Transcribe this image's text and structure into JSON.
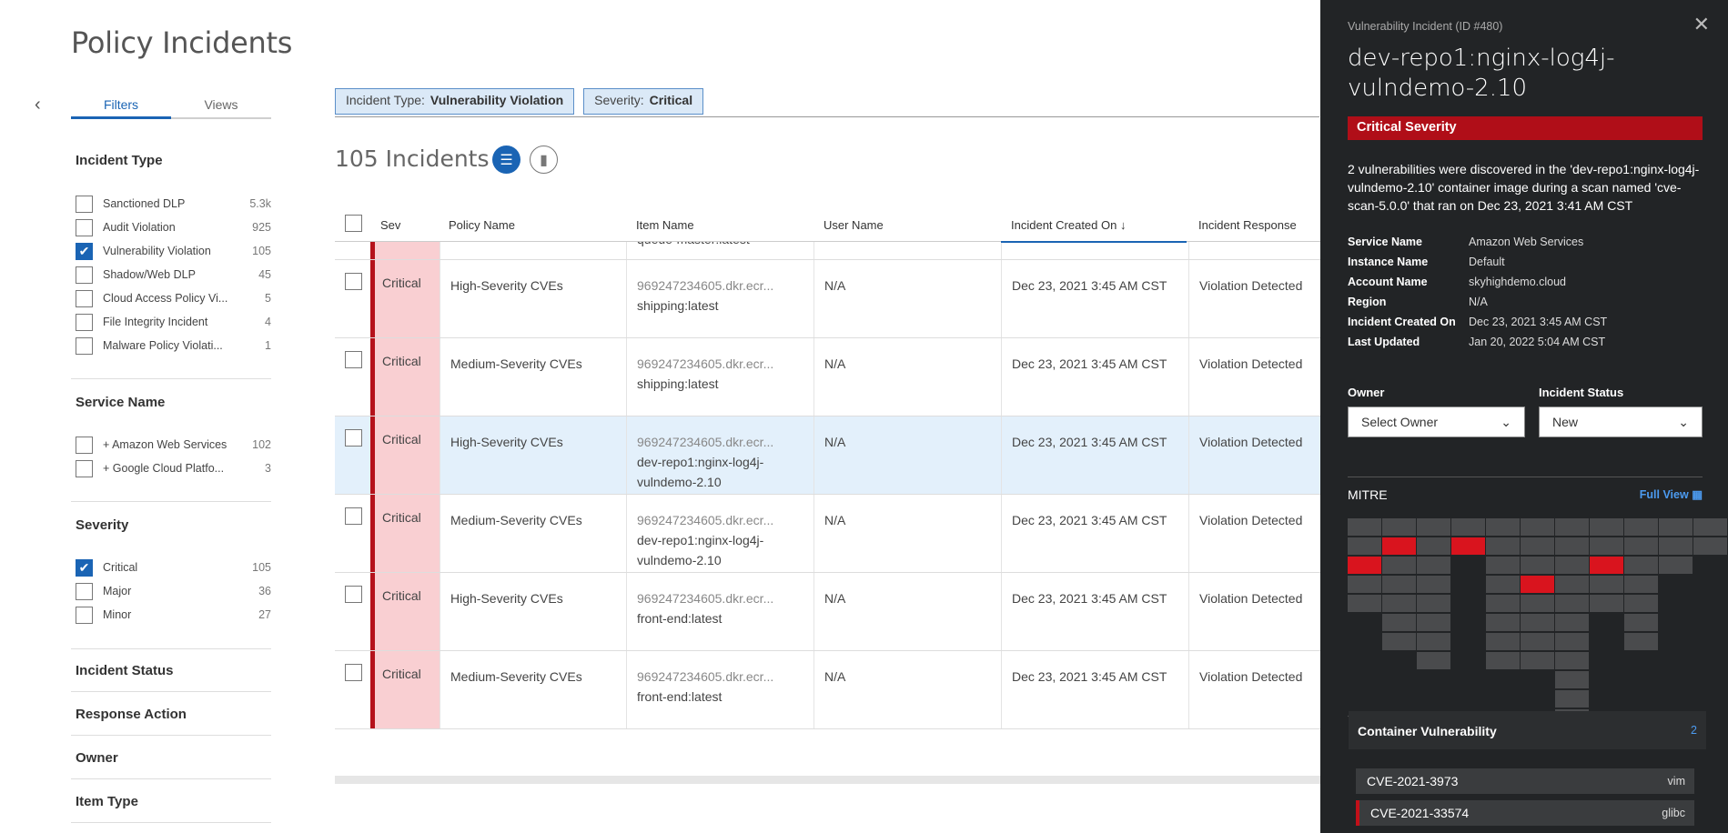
{
  "page": {
    "title": "Policy Incidents"
  },
  "sidebar": {
    "tabs": [
      {
        "label": "Filters"
      },
      {
        "label": "Views"
      }
    ],
    "incident_type": {
      "title": "Incident Type",
      "items": [
        {
          "label": "Sanctioned DLP",
          "count": "5.3k",
          "checked": false
        },
        {
          "label": "Audit Violation",
          "count": "925",
          "checked": false
        },
        {
          "label": "Vulnerability Violation",
          "count": "105",
          "checked": true
        },
        {
          "label": "Shadow/Web DLP",
          "count": "45",
          "checked": false
        },
        {
          "label": "Cloud Access Policy Vi...",
          "count": "5",
          "checked": false
        },
        {
          "label": "File Integrity Incident",
          "count": "4",
          "checked": false
        },
        {
          "label": "Malware Policy Violati...",
          "count": "1",
          "checked": false
        }
      ]
    },
    "service_name": {
      "title": "Service Name",
      "items": [
        {
          "label": "+ Amazon Web Services",
          "count": "102",
          "checked": false
        },
        {
          "label": "+ Google Cloud Platfo...",
          "count": "3",
          "checked": false
        }
      ]
    },
    "severity": {
      "title": "Severity",
      "items": [
        {
          "label": "Critical",
          "count": "105",
          "checked": true
        },
        {
          "label": "Major",
          "count": "36",
          "checked": false
        },
        {
          "label": "Minor",
          "count": "27",
          "checked": false
        }
      ]
    },
    "collapsed": [
      "Incident Status",
      "Response Action",
      "Owner",
      "Item Type"
    ]
  },
  "chips": [
    {
      "key": "Incident Type:",
      "value": "Vulnerability Violation"
    },
    {
      "key": "Severity:",
      "value": "Critical"
    }
  ],
  "main": {
    "count_title": "105 Incidents"
  },
  "table": {
    "headers": [
      "Sev",
      "Policy Name",
      "Item Name",
      "User Name",
      "Incident Created On",
      "Incident Response"
    ],
    "partial_row": {
      "item": "queue-master:latest"
    },
    "rows": [
      {
        "sev": "Critical",
        "policy": "High-Severity CVEs",
        "item_host": "969247234605.dkr.ecr...",
        "item_name": "shipping:latest",
        "user": "N/A",
        "created": "Dec 23, 2021 3:45 AM CST",
        "response": "Violation Detected"
      },
      {
        "sev": "Critical",
        "policy": "Medium-Severity CVEs",
        "item_host": "969247234605.dkr.ecr...",
        "item_name": "shipping:latest",
        "user": "N/A",
        "created": "Dec 23, 2021 3:45 AM CST",
        "response": "Violation Detected"
      },
      {
        "sev": "Critical",
        "policy": "High-Severity CVEs",
        "item_host": "969247234605.dkr.ecr...",
        "item_name": "dev-repo1:nginx-log4j-",
        "item_name2": "vulndemo-2.10",
        "user": "N/A",
        "created": "Dec 23, 2021 3:45 AM CST",
        "response": "Violation Detected"
      },
      {
        "sev": "Critical",
        "policy": "Medium-Severity CVEs",
        "item_host": "969247234605.dkr.ecr...",
        "item_name": "dev-repo1:nginx-log4j-",
        "item_name2": "vulndemo-2.10",
        "user": "N/A",
        "created": "Dec 23, 2021 3:45 AM CST",
        "response": "Violation Detected"
      },
      {
        "sev": "Critical",
        "policy": "High-Severity CVEs",
        "item_host": "969247234605.dkr.ecr...",
        "item_name": "front-end:latest",
        "user": "N/A",
        "created": "Dec 23, 2021 3:45 AM CST",
        "response": "Violation Detected"
      },
      {
        "sev": "Critical",
        "policy": "Medium-Severity CVEs",
        "item_host": "969247234605.dkr.ecr...",
        "item_name": "front-end:latest",
        "user": "N/A",
        "created": "Dec 23, 2021 3:45 AM CST",
        "response": "Violation Detected"
      }
    ]
  },
  "panel": {
    "small_title": "Vulnerability Incident (ID #480)",
    "title": "dev-repo1:nginx-log4j-vulndemo-2.10",
    "severity": "Critical Severity",
    "description": "2 vulnerabilities were discovered in the 'dev-repo1:nginx-log4j-vulndemo-2.10' container image during a scan named 'cve-scan-5.0.0' that ran on Dec 23, 2021 3:41 AM CST",
    "details": [
      {
        "k": "Service Name",
        "v": "Amazon Web Services"
      },
      {
        "k": "Instance Name",
        "v": "Default"
      },
      {
        "k": "Account Name",
        "v": "skyhighdemo.cloud"
      },
      {
        "k": "Region",
        "v": "N/A"
      },
      {
        "k": "Incident Created On",
        "v": "Dec 23, 2021 3:45 AM CST"
      },
      {
        "k": "Last Updated",
        "v": "Jan 20, 2022 5:04 AM CST"
      }
    ],
    "owner": {
      "label": "Owner",
      "value": "Select Owner"
    },
    "status": {
      "label": "Incident Status",
      "value": "New"
    },
    "mitre": {
      "title": "MITRE",
      "full_view": "Full View"
    },
    "container_vuln": {
      "title": "Container Vulnerability",
      "count": "2",
      "items": [
        {
          "cve": "CVE-2021-3973",
          "package": "vim"
        },
        {
          "cve": "CVE-2021-33574",
          "package": "glibc"
        }
      ]
    }
  }
}
